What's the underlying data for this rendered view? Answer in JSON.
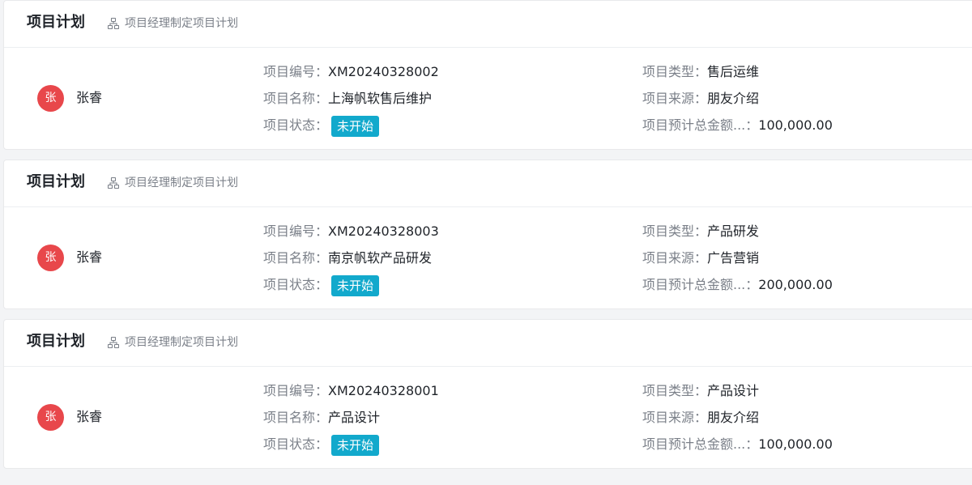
{
  "cards": [
    {
      "title": "项目计划",
      "subtitle": "项目经理制定项目计划",
      "owner": {
        "avatar_char": "张",
        "name": "张睿"
      },
      "fields": {
        "code_label": "项目编号：",
        "code": "XM20240328002",
        "name_label": "项目名称：",
        "name": "上海帆软售后维护",
        "status_label": "项目状态：",
        "status": "未开始",
        "type_label": "项目类型：",
        "type": "售后运维",
        "source_label": "项目来源：",
        "source": "朋友介绍",
        "amount_label": "项目预计总金额...：",
        "amount": "100,000.00"
      }
    },
    {
      "title": "项目计划",
      "subtitle": "项目经理制定项目计划",
      "owner": {
        "avatar_char": "张",
        "name": "张睿"
      },
      "fields": {
        "code_label": "项目编号：",
        "code": "XM20240328003",
        "name_label": "项目名称：",
        "name": "南京帆软产品研发",
        "status_label": "项目状态：",
        "status": "未开始",
        "type_label": "项目类型：",
        "type": "产品研发",
        "source_label": "项目来源：",
        "source": "广告营销",
        "amount_label": "项目预计总金额...：",
        "amount": "200,000.00"
      }
    },
    {
      "title": "项目计划",
      "subtitle": "项目经理制定项目计划",
      "owner": {
        "avatar_char": "张",
        "name": "张睿"
      },
      "fields": {
        "code_label": "项目编号：",
        "code": "XM20240328001",
        "name_label": "项目名称：",
        "name": "产品设计",
        "status_label": "项目状态：",
        "status": "未开始",
        "type_label": "项目类型：",
        "type": "产品设计",
        "source_label": "项目来源：",
        "source": "朋友介绍",
        "amount_label": "项目预计总金额...：",
        "amount": "100,000.00"
      }
    }
  ],
  "icons": {
    "subtitle_icon": "flow-chart-icon"
  },
  "colors": {
    "avatar_bg": "#e8474b",
    "status_badge_bg": "#12a9cc",
    "label_text": "#7b8089",
    "value_text": "#1f2329"
  }
}
